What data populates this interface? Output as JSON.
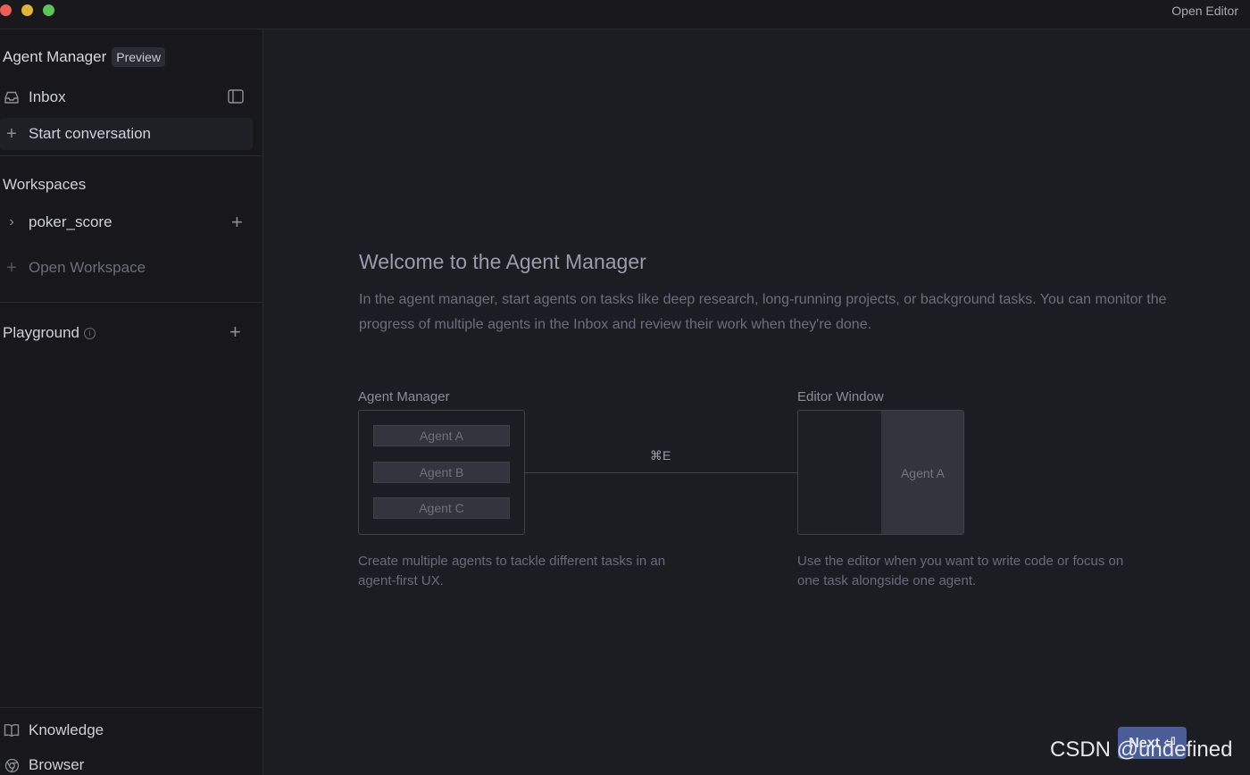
{
  "titlebar": {
    "open_editor": "Open Editor"
  },
  "sidebar": {
    "title": "Agent Manager",
    "badge": "Preview",
    "inbox": "Inbox",
    "start_conversation": "Start conversation",
    "workspaces_title": "Workspaces",
    "workspace_item": "poker_score",
    "open_workspace": "Open Workspace",
    "playground_title": "Playground",
    "knowledge": "Knowledge",
    "browser": "Browser"
  },
  "main": {
    "title": "Welcome to the Agent Manager",
    "description": "In the agent manager, start agents on tasks like deep research, long-running projects, or background tasks. You can monitor the progress of multiple agents in the Inbox and review their work when they're done.",
    "diagram": {
      "left_label": "Agent Manager",
      "agents": [
        "Agent A",
        "Agent B",
        "Agent C"
      ],
      "shortcut": "⌘E",
      "right_label": "Editor Window",
      "editor_agent": "Agent A",
      "left_caption": "Create multiple agents to tackle different tasks in an agent-first UX.",
      "right_caption": "Use the editor when you want to write code or focus on one task alongside one agent."
    },
    "next_button": "Next ⏎"
  },
  "watermark": "CSDN @undefined"
}
